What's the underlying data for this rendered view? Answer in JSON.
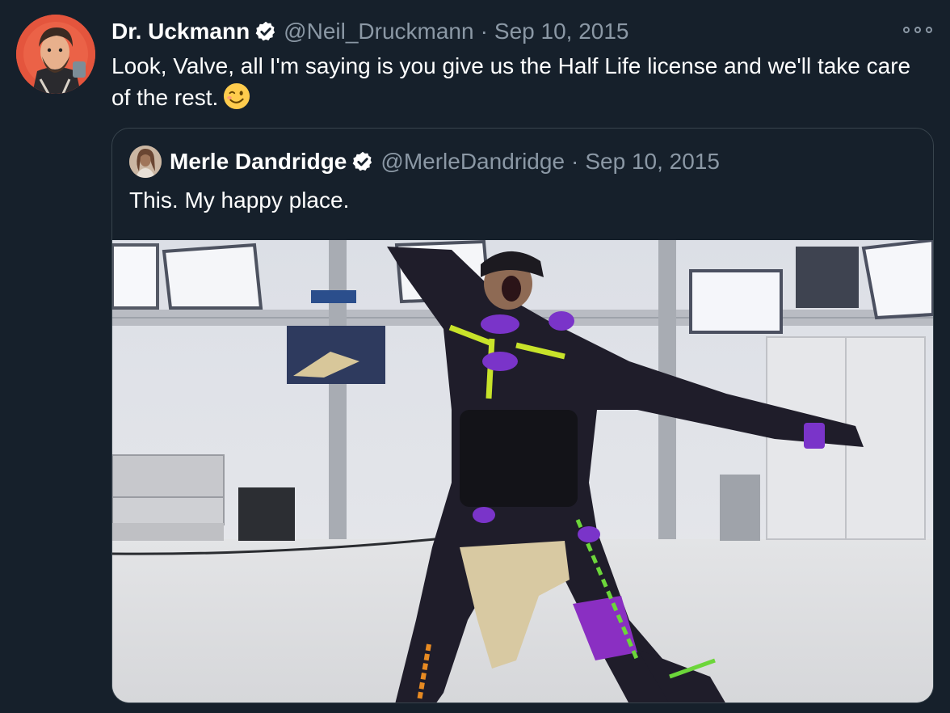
{
  "tweet": {
    "author_name": "Dr. Uckmann",
    "handle": "@Neil_Druckmann",
    "separator": "·",
    "date": "Sep 10, 2015",
    "text": "Look, Valve, all I'm saying is you give us the Half Life license and we'll take care of the rest."
  },
  "quoted_tweet": {
    "author_name": "Merle Dandridge",
    "handle": "@MerleDandridge",
    "separator": "·",
    "date": "Sep 10, 2015",
    "text": "This. My happy place."
  },
  "icons": {
    "verified": "verified-badge-icon",
    "more": "more-options-icon",
    "emoji": "winking-face-emoji"
  },
  "colors": {
    "background": "#16202b",
    "muted_text": "#8b98a5",
    "border": "#38444d",
    "primary_text": "#ffffff"
  }
}
